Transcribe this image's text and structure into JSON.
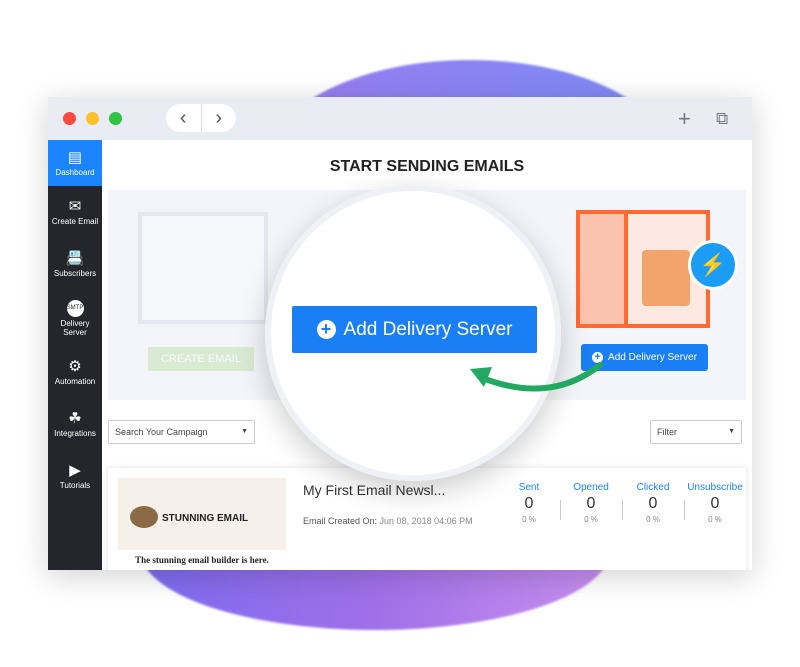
{
  "window": {
    "nav_back": "‹",
    "nav_forward": "›",
    "new_tab_icon": "plus-icon",
    "tabs_icon": "copy-icon"
  },
  "sidebar": {
    "items": [
      {
        "label": "Dashboard",
        "icon": "▤",
        "active": true
      },
      {
        "label": "Create Email",
        "icon": "✉"
      },
      {
        "label": "Subscribers",
        "icon": "📇"
      },
      {
        "label": "Delivery Server",
        "icon": "SMTP"
      },
      {
        "label": "Automation",
        "icon": "⚙"
      },
      {
        "label": "Integrations",
        "icon": "☘"
      },
      {
        "label": "Tutorials",
        "icon": "▶"
      }
    ]
  },
  "main": {
    "title": "START SENDING EMAILS",
    "create_email_label": "CREATE EMAIL",
    "add_server_label": "Add Delivery Server",
    "add_server_zoomed_label": "Add Delivery Server",
    "search_placeholder": "Search Your Campaign",
    "filter_label": "Filter"
  },
  "campaign": {
    "thumb_title": "STUNNING EMAIL",
    "thumb_caption": "The stunning email builder is here.",
    "title": "My First Email Newsl...",
    "created_label": "Email Created On:",
    "created_value": "Jun 08, 2018 04:06 PM",
    "stats": [
      {
        "label": "Sent",
        "value": "0",
        "pct": "0 %"
      },
      {
        "label": "Opened",
        "value": "0",
        "pct": "0 %"
      },
      {
        "label": "Clicked",
        "value": "0",
        "pct": "0 %"
      },
      {
        "label": "Unsubscribe",
        "value": "0",
        "pct": "0 %"
      }
    ]
  },
  "colors": {
    "accent": "#1a7ff5",
    "sidebar": "#24262b",
    "arrow": "#22a861",
    "orange": "#ff6a33"
  }
}
